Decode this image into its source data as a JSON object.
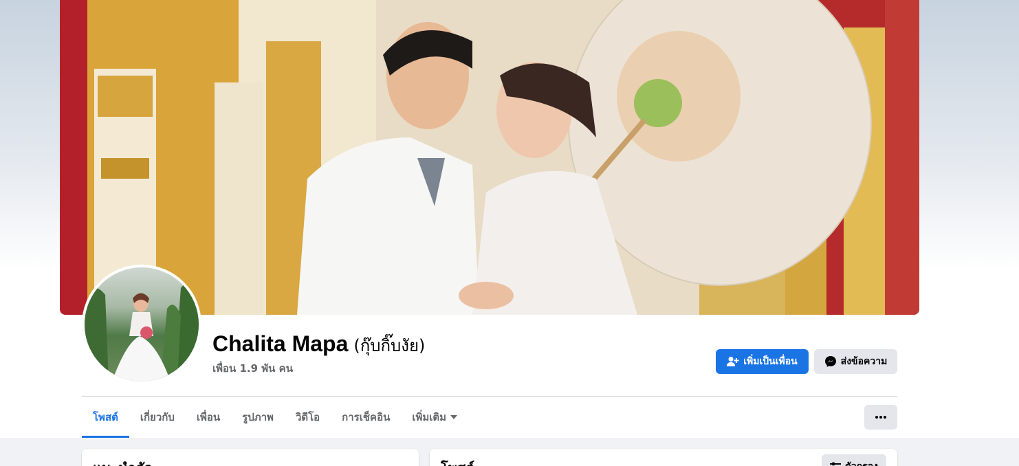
{
  "profile": {
    "name": "Chalita Mapa",
    "alternate_name": "(กุ๊บกิ๊บงัย)",
    "friends_count": "เพื่อน 1.9 พัน คน"
  },
  "actions": {
    "add_friend_label": "เพิ่มเป็นเพื่อน",
    "message_label": "ส่งข้อความ"
  },
  "tabs": [
    {
      "label": "โพสต์",
      "active": true
    },
    {
      "label": "เกี่ยวกับ",
      "active": false
    },
    {
      "label": "เพื่อน",
      "active": false
    },
    {
      "label": "รูปภาพ",
      "active": false
    },
    {
      "label": "วิดีโอ",
      "active": false
    },
    {
      "label": "การเช็คอิน",
      "active": false
    },
    {
      "label": "เพิ่มเติม",
      "active": false
    }
  ],
  "cards": {
    "intro_title": "แนะนำตัว",
    "posts_title": "โพสต์",
    "filter_label": "ตัวกรอง"
  },
  "colors": {
    "accent": "#1b74e4",
    "secondary_button": "#e4e6eb",
    "text_primary": "#050505",
    "text_secondary": "#65676b"
  },
  "icons": {
    "add_friend": "person-plus-icon",
    "message": "messenger-icon",
    "more": "ellipsis-icon",
    "dropdown": "caret-down-icon",
    "filter": "sliders-icon"
  }
}
